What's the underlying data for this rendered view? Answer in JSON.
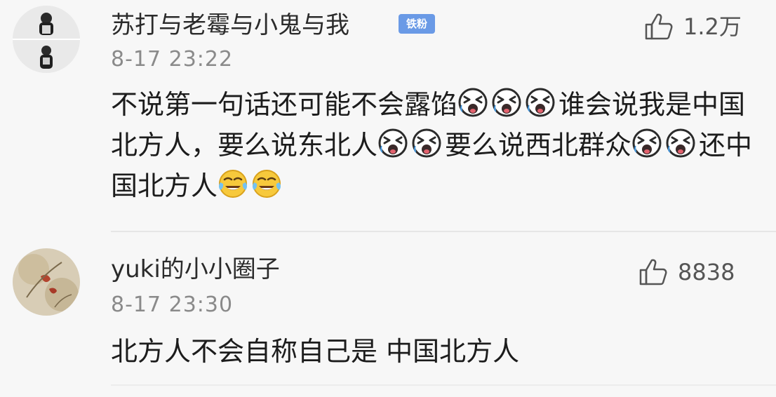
{
  "comments": [
    {
      "username": "苏打与老霉与小鬼与我",
      "badge": "铁粉",
      "timestamp": "8-17 23:22",
      "likes": "1.2万",
      "segments": [
        {
          "text": "不说第一句话还可能不会露馅"
        },
        {
          "emoji": "laughing-cry-face-icon"
        },
        {
          "emoji": "laughing-cry-face-icon"
        },
        {
          "emoji": "laughing-cry-face-icon"
        },
        {
          "text": "谁会说我是中国北方人，要么说东北人"
        },
        {
          "emoji": "laughing-cry-face-icon"
        },
        {
          "emoji": "laughing-cry-face-icon"
        },
        {
          "text": "要么说西北群众"
        },
        {
          "emoji": "laughing-cry-face-icon"
        },
        {
          "emoji": "laughing-cry-face-icon"
        },
        {
          "text": "还中国北方人"
        },
        {
          "emoji": "tears-of-joy-face-icon"
        },
        {
          "emoji": "tears-of-joy-face-icon"
        }
      ]
    },
    {
      "username": "yuki的小小圈子",
      "timestamp": "8-17 23:30",
      "likes": "8838",
      "segments": [
        {
          "text": "北方人不会自称自己是 中国北方人"
        }
      ]
    }
  ],
  "colors": {
    "background": "#f7f7f7",
    "username": "#2b2b2b",
    "timestamp": "#8a8a8a",
    "badge": "#6a9ae6",
    "body": "#1c1c1c"
  }
}
